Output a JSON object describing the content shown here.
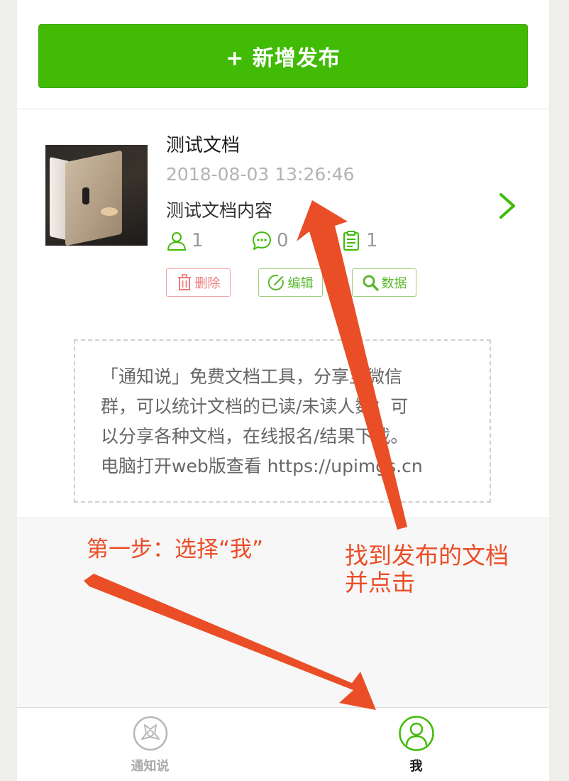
{
  "top": {
    "add_button": "+ 新增发布"
  },
  "document": {
    "title": "测试文档",
    "time": "2018-08-03 13:26:46",
    "content": "测试文档内容",
    "stats": {
      "readers": "1",
      "comments": "0",
      "forms": "1"
    },
    "actions": {
      "delete": "删除",
      "edit": "编辑",
      "data": "数据"
    }
  },
  "promo": {
    "lines": [
      "「通知说」免费文档工具，分享至微信",
      "群，可以统计文档的已读/未读人数；可",
      "以分享各种文档，在线报名/结果下载。",
      "电脑打开web版查看 https://upimgs.cn"
    ]
  },
  "tabbar": {
    "left_label": "通知说",
    "right_label": "我"
  },
  "annotations": {
    "step1": "第一步：选择“我”",
    "step2_line1": "找到发布的文档",
    "step2_line2": "并点击"
  },
  "colors": {
    "accent": "#41bb06",
    "arrow": "#ea4e27",
    "delete": "#ee7a7a"
  },
  "icons": [
    "person-icon",
    "comment-icon",
    "clipboard-icon",
    "trash-icon",
    "edit-icon",
    "search-icon",
    "chevron-right-icon",
    "app-logo-icon",
    "profile-icon"
  ]
}
